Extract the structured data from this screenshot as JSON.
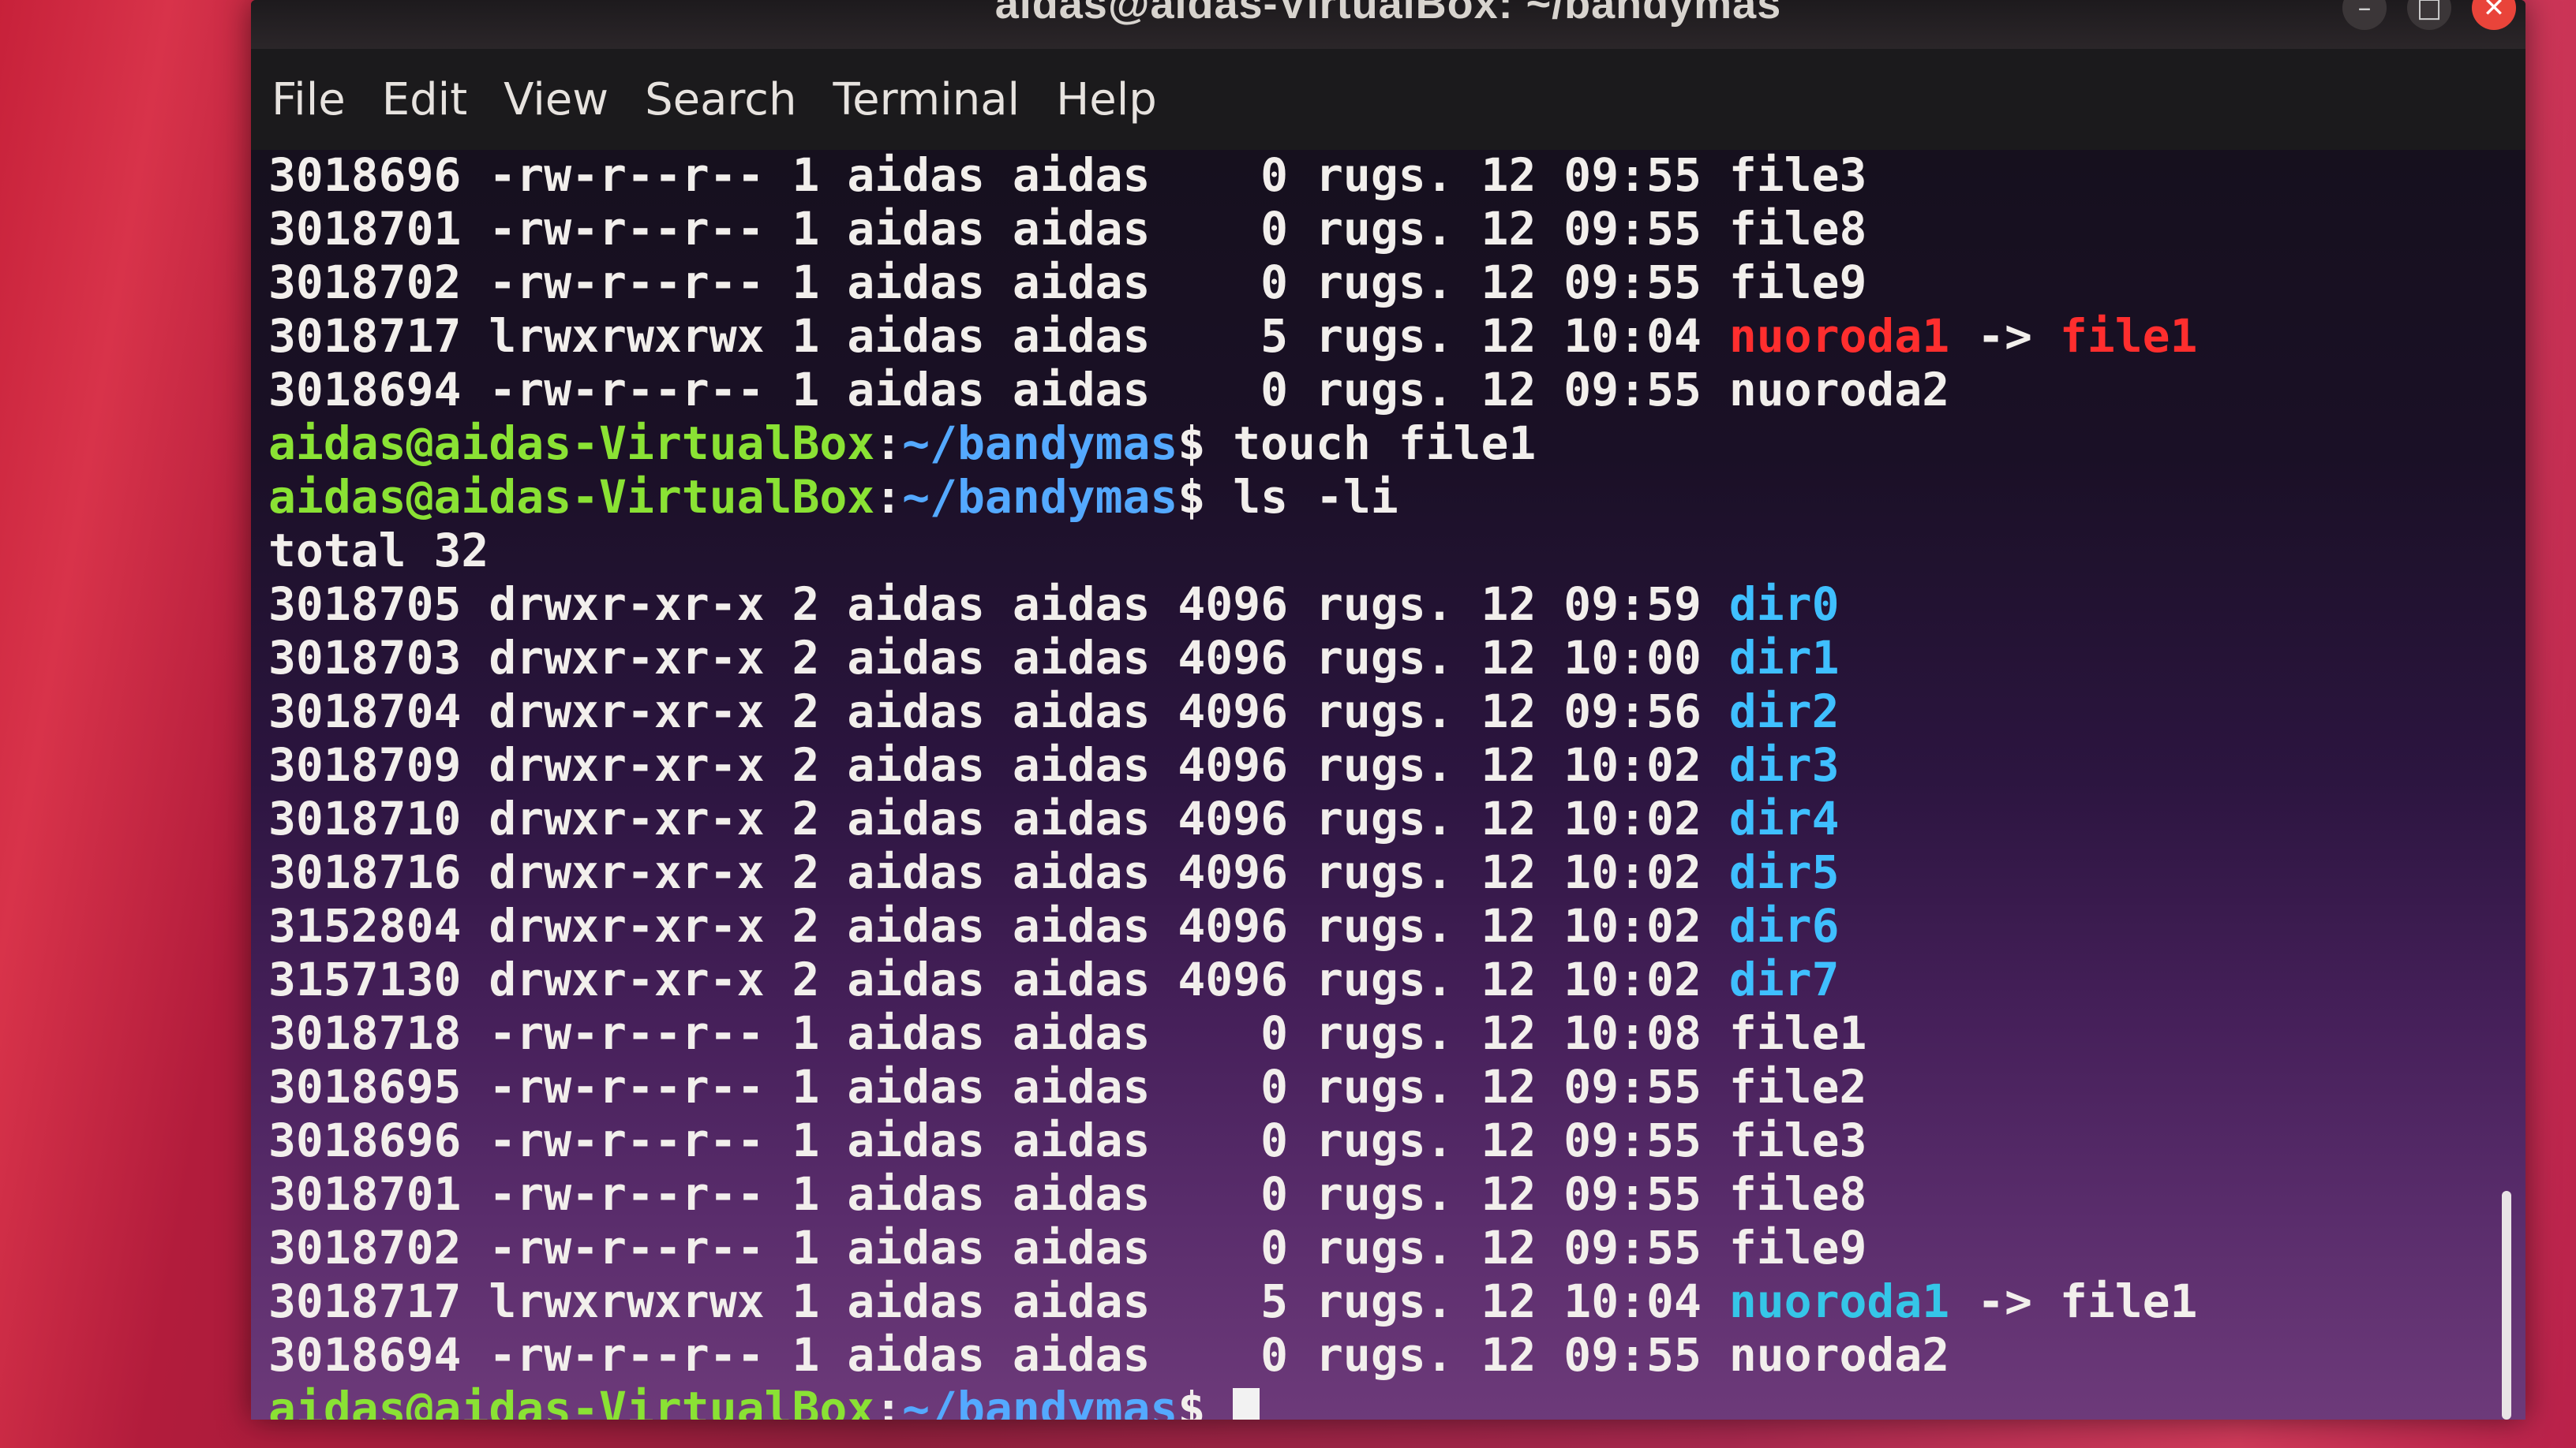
{
  "window": {
    "title": "aidas@aidas-VirtualBox: ~/bandymas",
    "close_glyph": "✕",
    "minimize_glyph": "–",
    "maximize_glyph": "□"
  },
  "menu": [
    "File",
    "Edit",
    "View",
    "Search",
    "Terminal",
    "Help"
  ],
  "prompt": {
    "user_host": "aidas@aidas-VirtualBox",
    "separator": ":",
    "path": "~/bandymas",
    "dollar": "$"
  },
  "colors": {
    "prompt_user": "#8ae234",
    "prompt_path": "#54a9ff",
    "directory": "#3fbfff",
    "broken_link": "#ff2e2e",
    "valid_link": "#35c6e8"
  },
  "prior_listing": [
    {
      "inode": "3018696",
      "perms": "-rw-r--r--",
      "links": "1",
      "owner": "aidas",
      "group": "aidas",
      "size": "0",
      "month": "rugs.",
      "day": "12",
      "time": "09:55",
      "name": "file3",
      "type": "file"
    },
    {
      "inode": "3018701",
      "perms": "-rw-r--r--",
      "links": "1",
      "owner": "aidas",
      "group": "aidas",
      "size": "0",
      "month": "rugs.",
      "day": "12",
      "time": "09:55",
      "name": "file8",
      "type": "file"
    },
    {
      "inode": "3018702",
      "perms": "-rw-r--r--",
      "links": "1",
      "owner": "aidas",
      "group": "aidas",
      "size": "0",
      "month": "rugs.",
      "day": "12",
      "time": "09:55",
      "name": "file9",
      "type": "file"
    },
    {
      "inode": "3018717",
      "perms": "lrwxrwxrwx",
      "links": "1",
      "owner": "aidas",
      "group": "aidas",
      "size": "5",
      "month": "rugs.",
      "day": "12",
      "time": "10:04",
      "name": "nuoroda1",
      "type": "broken-link",
      "arrow": "->",
      "target": "file1"
    },
    {
      "inode": "3018694",
      "perms": "-rw-r--r--",
      "links": "1",
      "owner": "aidas",
      "group": "aidas",
      "size": "0",
      "month": "rugs.",
      "day": "12",
      "time": "09:55",
      "name": "nuoroda2",
      "type": "file"
    }
  ],
  "commands": [
    "touch file1",
    "ls -li"
  ],
  "total_line": "total 32",
  "listing": [
    {
      "inode": "3018705",
      "perms": "drwxr-xr-x",
      "links": "2",
      "owner": "aidas",
      "group": "aidas",
      "size": "4096",
      "month": "rugs.",
      "day": "12",
      "time": "09:59",
      "name": "dir0",
      "type": "dir"
    },
    {
      "inode": "3018703",
      "perms": "drwxr-xr-x",
      "links": "2",
      "owner": "aidas",
      "group": "aidas",
      "size": "4096",
      "month": "rugs.",
      "day": "12",
      "time": "10:00",
      "name": "dir1",
      "type": "dir"
    },
    {
      "inode": "3018704",
      "perms": "drwxr-xr-x",
      "links": "2",
      "owner": "aidas",
      "group": "aidas",
      "size": "4096",
      "month": "rugs.",
      "day": "12",
      "time": "09:56",
      "name": "dir2",
      "type": "dir"
    },
    {
      "inode": "3018709",
      "perms": "drwxr-xr-x",
      "links": "2",
      "owner": "aidas",
      "group": "aidas",
      "size": "4096",
      "month": "rugs.",
      "day": "12",
      "time": "10:02",
      "name": "dir3",
      "type": "dir"
    },
    {
      "inode": "3018710",
      "perms": "drwxr-xr-x",
      "links": "2",
      "owner": "aidas",
      "group": "aidas",
      "size": "4096",
      "month": "rugs.",
      "day": "12",
      "time": "10:02",
      "name": "dir4",
      "type": "dir"
    },
    {
      "inode": "3018716",
      "perms": "drwxr-xr-x",
      "links": "2",
      "owner": "aidas",
      "group": "aidas",
      "size": "4096",
      "month": "rugs.",
      "day": "12",
      "time": "10:02",
      "name": "dir5",
      "type": "dir"
    },
    {
      "inode": "3152804",
      "perms": "drwxr-xr-x",
      "links": "2",
      "owner": "aidas",
      "group": "aidas",
      "size": "4096",
      "month": "rugs.",
      "day": "12",
      "time": "10:02",
      "name": "dir6",
      "type": "dir"
    },
    {
      "inode": "3157130",
      "perms": "drwxr-xr-x",
      "links": "2",
      "owner": "aidas",
      "group": "aidas",
      "size": "4096",
      "month": "rugs.",
      "day": "12",
      "time": "10:02",
      "name": "dir7",
      "type": "dir"
    },
    {
      "inode": "3018718",
      "perms": "-rw-r--r--",
      "links": "1",
      "owner": "aidas",
      "group": "aidas",
      "size": "0",
      "month": "rugs.",
      "day": "12",
      "time": "10:08",
      "name": "file1",
      "type": "file"
    },
    {
      "inode": "3018695",
      "perms": "-rw-r--r--",
      "links": "1",
      "owner": "aidas",
      "group": "aidas",
      "size": "0",
      "month": "rugs.",
      "day": "12",
      "time": "09:55",
      "name": "file2",
      "type": "file"
    },
    {
      "inode": "3018696",
      "perms": "-rw-r--r--",
      "links": "1",
      "owner": "aidas",
      "group": "aidas",
      "size": "0",
      "month": "rugs.",
      "day": "12",
      "time": "09:55",
      "name": "file3",
      "type": "file"
    },
    {
      "inode": "3018701",
      "perms": "-rw-r--r--",
      "links": "1",
      "owner": "aidas",
      "group": "aidas",
      "size": "0",
      "month": "rugs.",
      "day": "12",
      "time": "09:55",
      "name": "file8",
      "type": "file"
    },
    {
      "inode": "3018702",
      "perms": "-rw-r--r--",
      "links": "1",
      "owner": "aidas",
      "group": "aidas",
      "size": "0",
      "month": "rugs.",
      "day": "12",
      "time": "09:55",
      "name": "file9",
      "type": "file"
    },
    {
      "inode": "3018717",
      "perms": "lrwxrwxrwx",
      "links": "1",
      "owner": "aidas",
      "group": "aidas",
      "size": "5",
      "month": "rugs.",
      "day": "12",
      "time": "10:04",
      "name": "nuoroda1",
      "type": "valid-link",
      "arrow": "->",
      "target": "file1"
    },
    {
      "inode": "3018694",
      "perms": "-rw-r--r--",
      "links": "1",
      "owner": "aidas",
      "group": "aidas",
      "size": "0",
      "month": "rugs.",
      "day": "12",
      "time": "09:55",
      "name": "nuoroda2",
      "type": "file"
    }
  ]
}
